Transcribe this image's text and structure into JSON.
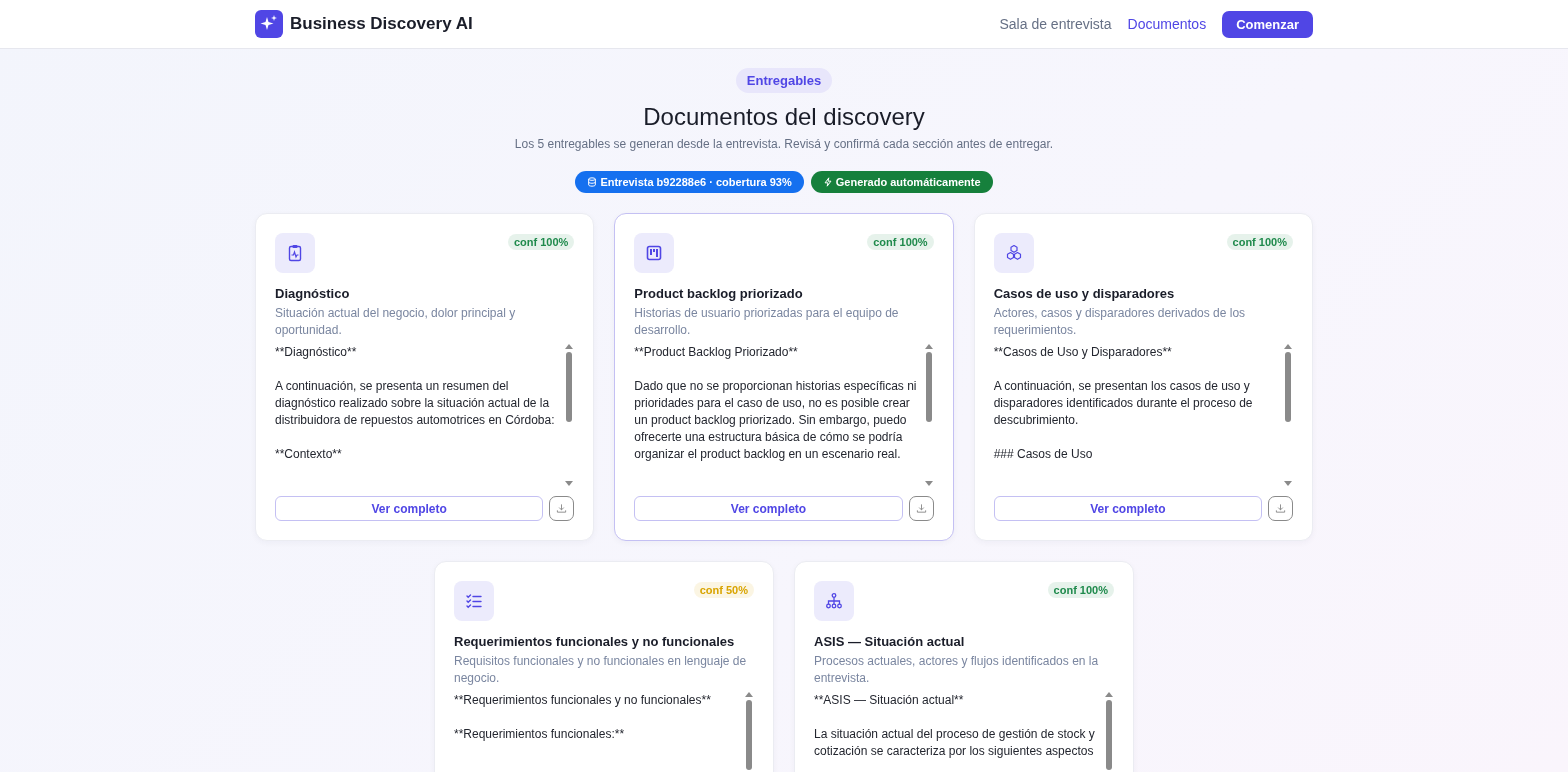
{
  "nav": {
    "brand": "Business Discovery AI",
    "links": [
      {
        "label": "Sala de entrevista",
        "selected": false
      },
      {
        "label": "Documentos",
        "selected": true
      }
    ],
    "cta": "Comenzar"
  },
  "hero": {
    "eyebrow": "Entregables",
    "title": "Documentos del discovery",
    "subtitle": "Los 5 entregables se generan desde la entrevista. Revisá y confirmá cada sección antes de entregar.",
    "badges": [
      {
        "kind": "interview",
        "label": "Entrevista b92288e6 · cobertura 93%",
        "color": "#1570ef"
      },
      {
        "kind": "auto",
        "label": "Generado automáticamente",
        "color": "#16803c"
      }
    ]
  },
  "documents": [
    {
      "title": "Diagnóstico",
      "description": "Situación actual del negocio, dolor principal y oportunidad.",
      "confidence": "conf 100%",
      "color": "#1f8a4c",
      "selected": false,
      "preview": [
        "**Diagnóstico**",
        "A continuación, se presenta un resumen del diagnóstico realizado sobre la situación actual de la distribuidora de repuestos automotrices en Córdoba:",
        "**Contexto**"
      ],
      "action": "Ver completo"
    },
    {
      "title": "Product backlog priorizado",
      "description": "Historias de usuario priorizadas para el equipo de desarrollo.",
      "confidence": "conf 100%",
      "color": "#1f8a4c",
      "selected": true,
      "preview": [
        "**Product Backlog Priorizado**",
        "Dado que no se proporcionan historias específicas ni prioridades para el caso de uso, no es posible crear un product backlog priorizado. Sin embargo, puedo ofrecerte una estructura básica de cómo se podría organizar el product backlog en un escenario real."
      ],
      "action": "Ver completo"
    },
    {
      "title": "Casos de uso y disparadores",
      "description": "Actores, casos y disparadores derivados de los requerimientos.",
      "confidence": "conf 100%",
      "color": "#1f8a4c",
      "selected": false,
      "preview": [
        "**Casos de Uso y Disparadores**",
        "A continuación, se presentan los casos de uso y disparadores identificados durante el proceso de descubrimiento.",
        "### Casos de Uso"
      ],
      "action": "Ver completo"
    },
    {
      "title": "Requerimientos funcionales y no funcionales",
      "description": "Requisitos funcionales y no funcionales en lenguaje de negocio.",
      "confidence": "conf 50%",
      "color": "#d9a400",
      "selected": false,
      "preview": [
        "**Requerimientos funcionales y no funcionales**",
        "**Requerimientos funcionales:**"
      ]
    },
    {
      "title": "ASIS — Situación actual",
      "description": "Procesos actuales, actores y flujos identificados en la entrevista.",
      "confidence": "conf 100%",
      "color": "#1f8a4c",
      "selected": false,
      "preview": [
        "**ASIS — Situación actual**",
        "La situación actual del proceso de gestión de stock y cotización se caracteriza por los siguientes aspectos"
      ]
    }
  ]
}
